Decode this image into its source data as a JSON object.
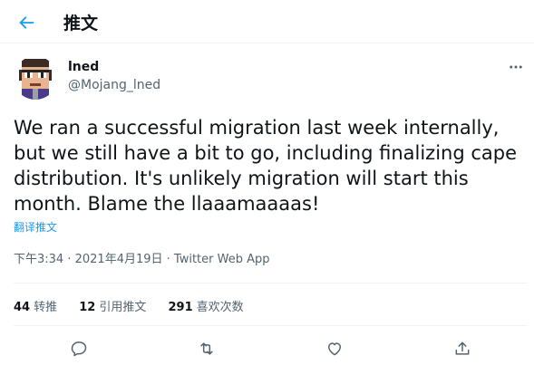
{
  "header": {
    "title": "推文",
    "back_icon": "arrow-left-icon"
  },
  "author": {
    "name": "lned",
    "handle": "@Mojang_lned"
  },
  "tweet": {
    "text": "We ran a successful migration last week internally, but we still have a bit to go, including finalizing cape distribution. It's unlikely migration will start this month. Blame the llaaamaaaas!",
    "translate": "翻译推文"
  },
  "meta": {
    "time": "下午3:34",
    "separator": " · ",
    "date": "2021年4月19日",
    "source": "Twitter Web App"
  },
  "stats": {
    "retweets": {
      "count": "44",
      "label": "转推"
    },
    "quotes": {
      "count": "12",
      "label": "引用推文"
    },
    "likes": {
      "count": "291",
      "label": "喜欢次数"
    }
  },
  "actions": [
    "reply-icon",
    "retweet-icon",
    "like-icon",
    "share-icon"
  ],
  "colors": {
    "accent": "#1d9bf0",
    "text": "#0f1419",
    "secondary": "#536471",
    "border": "#eff3f4"
  }
}
